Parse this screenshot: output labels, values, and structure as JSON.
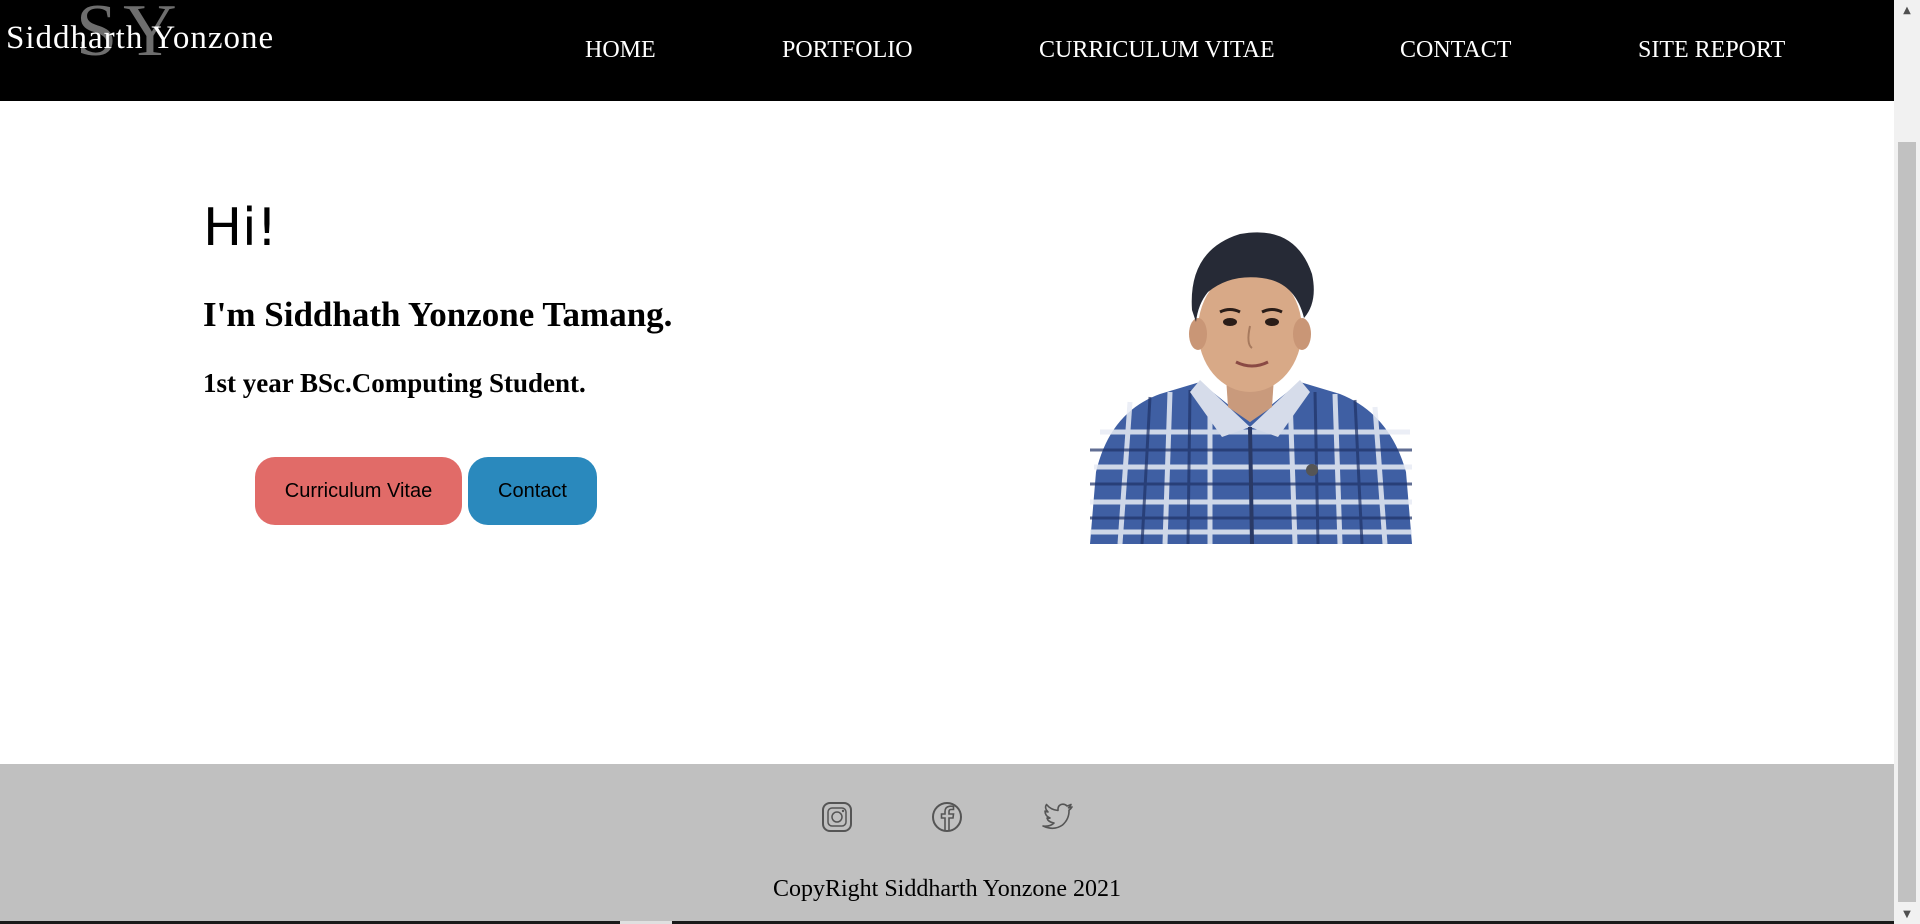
{
  "header": {
    "logo_monogram": "SY",
    "logo_text": "Siddharth Yonzone",
    "nav": [
      {
        "label": "HOME"
      },
      {
        "label": "PORTFOLIO"
      },
      {
        "label": "CURRICULUM VITAE"
      },
      {
        "label": "CONTACT"
      },
      {
        "label": "SITE REPORT"
      }
    ]
  },
  "hero": {
    "greeting": "Hi!",
    "name": "I'm Siddhath Yonzone Tamang.",
    "subtitle": "1st year BSc.Computing Student.",
    "buttons": {
      "cv_label": "Curriculum Vitae",
      "contact_label": "Contact"
    }
  },
  "footer": {
    "social_icons": [
      "instagram-icon",
      "facebook-icon",
      "twitter-icon"
    ],
    "copyright": "CopyRight Siddharth Yonzone 2021"
  },
  "colors": {
    "header_bg": "#000000",
    "footer_bg": "#c0c0c0",
    "cv_button": "#e16b68",
    "contact_button": "#2a89bd"
  }
}
